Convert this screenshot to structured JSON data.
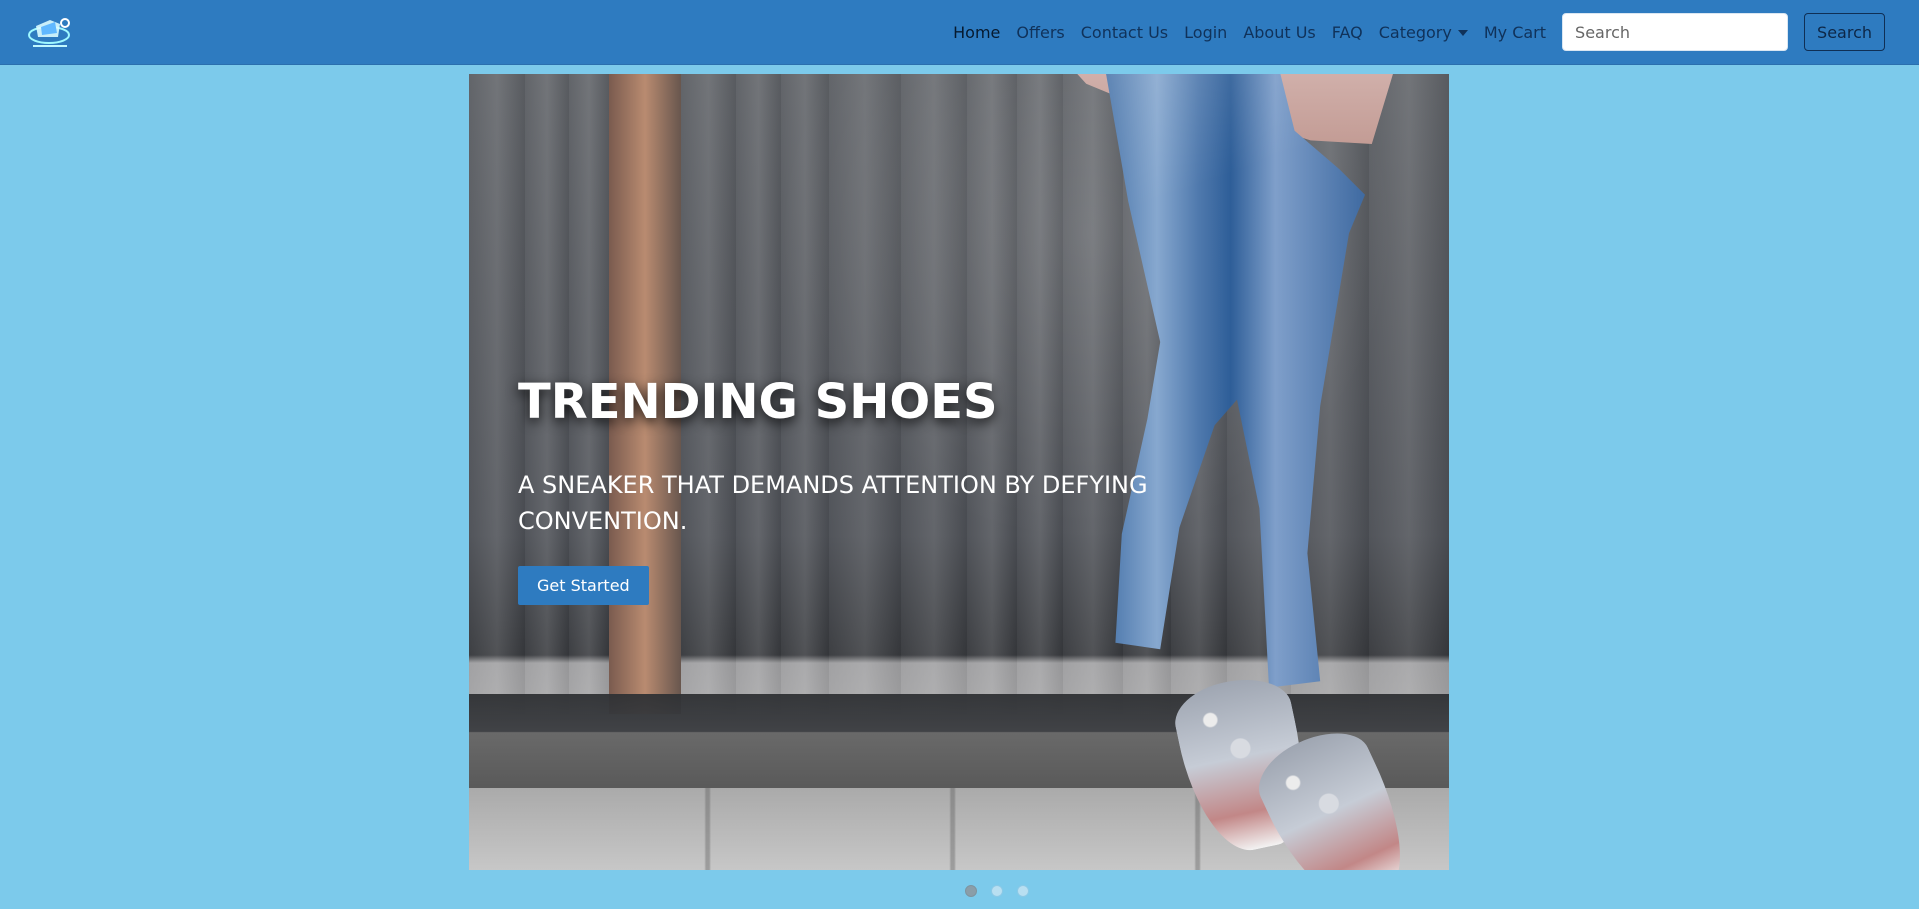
{
  "brand": {
    "logo_icon": "shoe-logo-icon"
  },
  "nav": {
    "items": [
      {
        "label": "Home",
        "active": true
      },
      {
        "label": "Offers"
      },
      {
        "label": "Contact Us"
      },
      {
        "label": "Login"
      },
      {
        "label": "About Us"
      },
      {
        "label": "FAQ"
      },
      {
        "label": "Category"
      },
      {
        "label": "My Cart"
      }
    ],
    "search": {
      "placeholder": "Search",
      "button_label": "Search"
    }
  },
  "hero": {
    "title": "TRENDING SHOES",
    "subtitle": "A SNEAKER THAT DEMANDS ATTENTION BY DEFYING CONVENTION.",
    "cta_label": "Get Started"
  },
  "carousel": {
    "indicator_count": 3,
    "active_index": 0
  },
  "colors": {
    "page_background": "#7ccaeb",
    "navbar": "#2e7bc0",
    "button": "#2e7bc0"
  }
}
